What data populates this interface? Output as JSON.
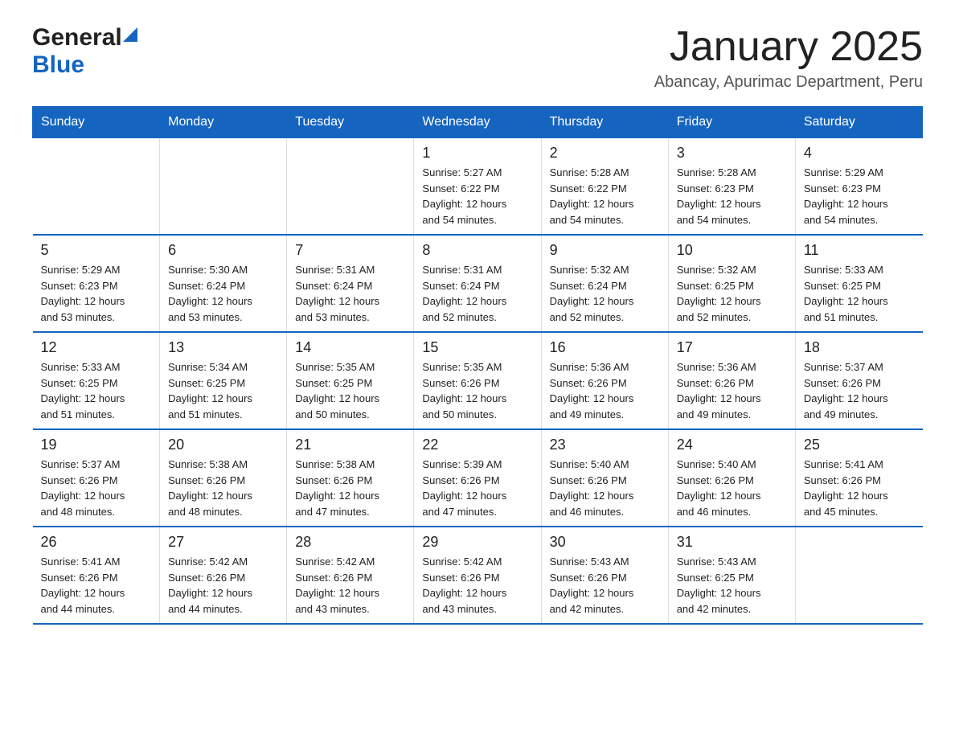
{
  "header": {
    "logo_general": "General",
    "logo_blue": "Blue",
    "title": "January 2025",
    "subtitle": "Abancay, Apurimac Department, Peru"
  },
  "days_of_week": [
    "Sunday",
    "Monday",
    "Tuesday",
    "Wednesday",
    "Thursday",
    "Friday",
    "Saturday"
  ],
  "weeks": [
    [
      {
        "day": "",
        "info": ""
      },
      {
        "day": "",
        "info": ""
      },
      {
        "day": "",
        "info": ""
      },
      {
        "day": "1",
        "info": "Sunrise: 5:27 AM\nSunset: 6:22 PM\nDaylight: 12 hours\nand 54 minutes."
      },
      {
        "day": "2",
        "info": "Sunrise: 5:28 AM\nSunset: 6:22 PM\nDaylight: 12 hours\nand 54 minutes."
      },
      {
        "day": "3",
        "info": "Sunrise: 5:28 AM\nSunset: 6:23 PM\nDaylight: 12 hours\nand 54 minutes."
      },
      {
        "day": "4",
        "info": "Sunrise: 5:29 AM\nSunset: 6:23 PM\nDaylight: 12 hours\nand 54 minutes."
      }
    ],
    [
      {
        "day": "5",
        "info": "Sunrise: 5:29 AM\nSunset: 6:23 PM\nDaylight: 12 hours\nand 53 minutes."
      },
      {
        "day": "6",
        "info": "Sunrise: 5:30 AM\nSunset: 6:24 PM\nDaylight: 12 hours\nand 53 minutes."
      },
      {
        "day": "7",
        "info": "Sunrise: 5:31 AM\nSunset: 6:24 PM\nDaylight: 12 hours\nand 53 minutes."
      },
      {
        "day": "8",
        "info": "Sunrise: 5:31 AM\nSunset: 6:24 PM\nDaylight: 12 hours\nand 52 minutes."
      },
      {
        "day": "9",
        "info": "Sunrise: 5:32 AM\nSunset: 6:24 PM\nDaylight: 12 hours\nand 52 minutes."
      },
      {
        "day": "10",
        "info": "Sunrise: 5:32 AM\nSunset: 6:25 PM\nDaylight: 12 hours\nand 52 minutes."
      },
      {
        "day": "11",
        "info": "Sunrise: 5:33 AM\nSunset: 6:25 PM\nDaylight: 12 hours\nand 51 minutes."
      }
    ],
    [
      {
        "day": "12",
        "info": "Sunrise: 5:33 AM\nSunset: 6:25 PM\nDaylight: 12 hours\nand 51 minutes."
      },
      {
        "day": "13",
        "info": "Sunrise: 5:34 AM\nSunset: 6:25 PM\nDaylight: 12 hours\nand 51 minutes."
      },
      {
        "day": "14",
        "info": "Sunrise: 5:35 AM\nSunset: 6:25 PM\nDaylight: 12 hours\nand 50 minutes."
      },
      {
        "day": "15",
        "info": "Sunrise: 5:35 AM\nSunset: 6:26 PM\nDaylight: 12 hours\nand 50 minutes."
      },
      {
        "day": "16",
        "info": "Sunrise: 5:36 AM\nSunset: 6:26 PM\nDaylight: 12 hours\nand 49 minutes."
      },
      {
        "day": "17",
        "info": "Sunrise: 5:36 AM\nSunset: 6:26 PM\nDaylight: 12 hours\nand 49 minutes."
      },
      {
        "day": "18",
        "info": "Sunrise: 5:37 AM\nSunset: 6:26 PM\nDaylight: 12 hours\nand 49 minutes."
      }
    ],
    [
      {
        "day": "19",
        "info": "Sunrise: 5:37 AM\nSunset: 6:26 PM\nDaylight: 12 hours\nand 48 minutes."
      },
      {
        "day": "20",
        "info": "Sunrise: 5:38 AM\nSunset: 6:26 PM\nDaylight: 12 hours\nand 48 minutes."
      },
      {
        "day": "21",
        "info": "Sunrise: 5:38 AM\nSunset: 6:26 PM\nDaylight: 12 hours\nand 47 minutes."
      },
      {
        "day": "22",
        "info": "Sunrise: 5:39 AM\nSunset: 6:26 PM\nDaylight: 12 hours\nand 47 minutes."
      },
      {
        "day": "23",
        "info": "Sunrise: 5:40 AM\nSunset: 6:26 PM\nDaylight: 12 hours\nand 46 minutes."
      },
      {
        "day": "24",
        "info": "Sunrise: 5:40 AM\nSunset: 6:26 PM\nDaylight: 12 hours\nand 46 minutes."
      },
      {
        "day": "25",
        "info": "Sunrise: 5:41 AM\nSunset: 6:26 PM\nDaylight: 12 hours\nand 45 minutes."
      }
    ],
    [
      {
        "day": "26",
        "info": "Sunrise: 5:41 AM\nSunset: 6:26 PM\nDaylight: 12 hours\nand 44 minutes."
      },
      {
        "day": "27",
        "info": "Sunrise: 5:42 AM\nSunset: 6:26 PM\nDaylight: 12 hours\nand 44 minutes."
      },
      {
        "day": "28",
        "info": "Sunrise: 5:42 AM\nSunset: 6:26 PM\nDaylight: 12 hours\nand 43 minutes."
      },
      {
        "day": "29",
        "info": "Sunrise: 5:42 AM\nSunset: 6:26 PM\nDaylight: 12 hours\nand 43 minutes."
      },
      {
        "day": "30",
        "info": "Sunrise: 5:43 AM\nSunset: 6:26 PM\nDaylight: 12 hours\nand 42 minutes."
      },
      {
        "day": "31",
        "info": "Sunrise: 5:43 AM\nSunset: 6:25 PM\nDaylight: 12 hours\nand 42 minutes."
      },
      {
        "day": "",
        "info": ""
      }
    ]
  ]
}
